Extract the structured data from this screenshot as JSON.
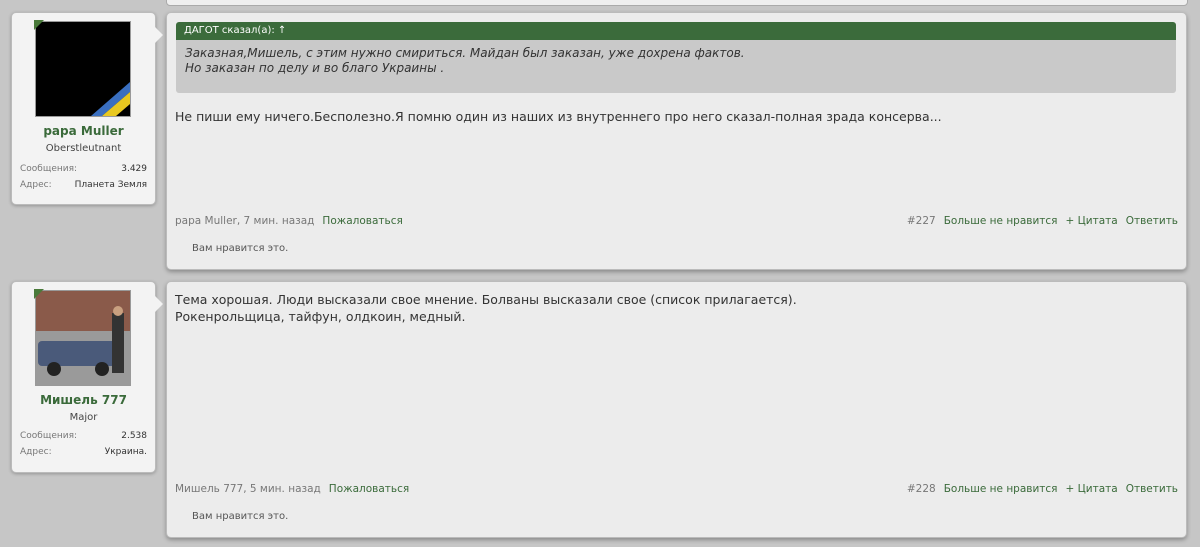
{
  "posts": [
    {
      "user": {
        "name": "papa Muller",
        "title": "Oberstleutnant",
        "messages_label": "Сообщения:",
        "messages": "3.429",
        "address_label": "Адрес:",
        "address": "Планета Земля"
      },
      "quote": {
        "header": "ДАГОТ сказал(а): ↑",
        "lines": [
          "Заказная,Мишель, с этим нужно смириться. Майдан был заказан, уже дохрена фактов.",
          "Но заказан по делу и во благо Украины ."
        ]
      },
      "message": [
        "Не пиши ему ничего.Бесполезно.Я помню один из наших из внутреннего про него сказал-полная зрада консерва..."
      ],
      "meta": {
        "author_time": "papa Muller, 7 мин. назад",
        "report": "Пожаловаться",
        "number": "#227",
        "unlike": "Больше не нравится",
        "quote": "+ Цитата",
        "reply": "Ответить"
      },
      "likes": "Вам нравится это."
    },
    {
      "user": {
        "name": "Мишель 777",
        "title": "Major",
        "messages_label": "Сообщения:",
        "messages": "2.538",
        "address_label": "Адрес:",
        "address": "Украина."
      },
      "message": [
        "Тема хорошая. Люди высказали свое мнение. Болваны высказали свое (список прилагается).",
        "Рокенрольщица, тайфун, олдкоин, медный."
      ],
      "meta": {
        "author_time": "Мишель 777, 5 мин. назад",
        "report": "Пожаловаться",
        "number": "#228",
        "unlike": "Больше не нравится",
        "quote": "+ Цитата",
        "reply": "Ответить"
      },
      "likes": "Вам нравится это."
    }
  ]
}
